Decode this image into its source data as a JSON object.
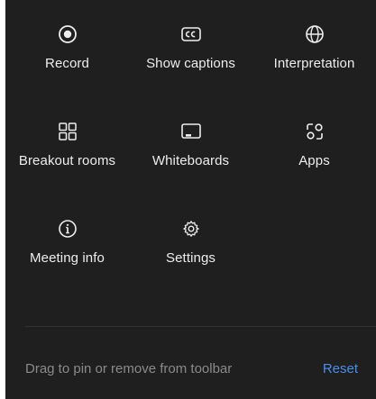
{
  "menu": {
    "items": [
      {
        "label": "Record",
        "icon": "record-icon"
      },
      {
        "label": "Show captions",
        "icon": "captions-icon"
      },
      {
        "label": "Interpretation",
        "icon": "globe-icon"
      },
      {
        "label": "Breakout rooms",
        "icon": "grid-icon"
      },
      {
        "label": "Whiteboards",
        "icon": "whiteboard-icon"
      },
      {
        "label": "Apps",
        "icon": "apps-icon"
      },
      {
        "label": "Meeting info",
        "icon": "info-icon"
      },
      {
        "label": "Settings",
        "icon": "gear-icon"
      }
    ]
  },
  "footer": {
    "hint": "Drag to pin or remove from toolbar",
    "reset_label": "Reset"
  },
  "colors": {
    "background": "#1f1f1f",
    "text": "#ededed",
    "hint": "#8a8a8a",
    "accent": "#4a8ee8"
  }
}
